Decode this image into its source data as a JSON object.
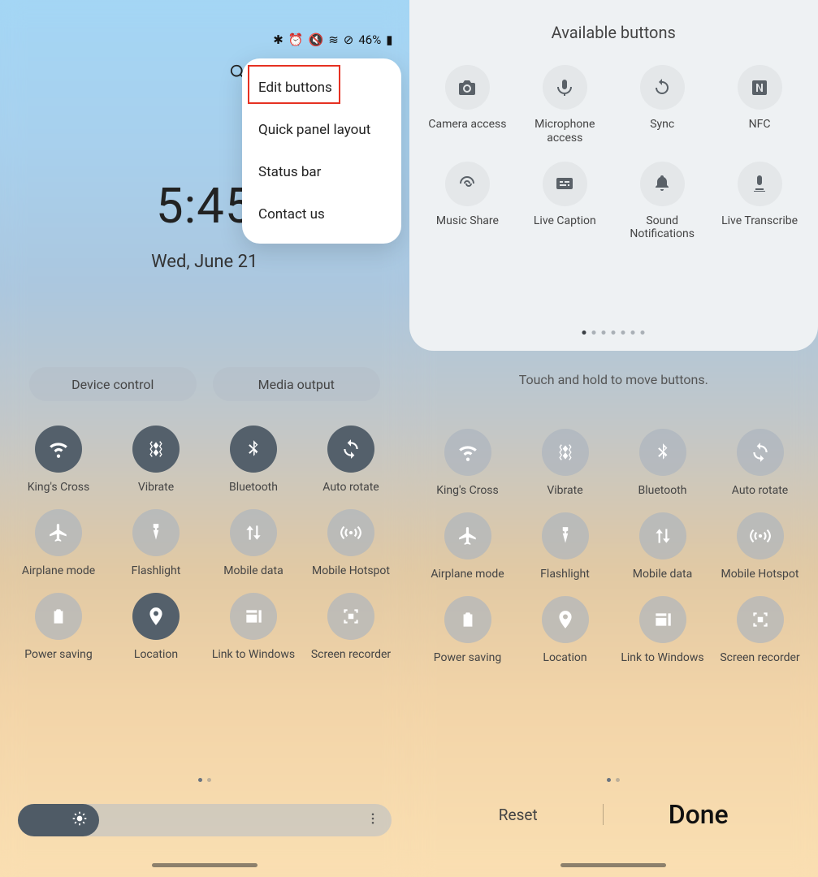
{
  "left": {
    "status": {
      "battery": "46%",
      "bt": "✱",
      "alarm": "⏰",
      "mute": "🔇",
      "wifi": "≋",
      "dnd": "⊘",
      "batt": "▮"
    },
    "time": "5:45",
    "date": "Wed, June 21",
    "pills": {
      "device_control": "Device control",
      "media_output": "Media output"
    },
    "menu": [
      {
        "label": "Edit buttons"
      },
      {
        "label": "Quick panel layout"
      },
      {
        "label": "Status bar"
      },
      {
        "label": "Contact us"
      }
    ]
  },
  "right": {
    "card_title": "Available buttons",
    "available": [
      {
        "label": "Camera access",
        "icon": "camera"
      },
      {
        "label": "Microphone access",
        "icon": "mic"
      },
      {
        "label": "Sync",
        "icon": "sync"
      },
      {
        "label": "NFC",
        "icon": "nfc"
      },
      {
        "label": "Music Share",
        "icon": "music"
      },
      {
        "label": "Live Caption",
        "icon": "caption"
      },
      {
        "label": "Sound Notifications",
        "icon": "bell"
      },
      {
        "label": "Live Transcribe",
        "icon": "transcribe"
      }
    ],
    "instr": "Touch and hold to move buttons.",
    "reset": "Reset",
    "done": "Done"
  },
  "qs": [
    {
      "label": "King's Cross",
      "icon": "wifi",
      "on": true
    },
    {
      "label": "Vibrate",
      "icon": "vibrate",
      "on": true
    },
    {
      "label": "Bluetooth",
      "icon": "bt",
      "on": true
    },
    {
      "label": "Auto rotate",
      "icon": "rotate",
      "on": true
    },
    {
      "label": "Airplane mode",
      "icon": "plane",
      "on": false
    },
    {
      "label": "Flashlight",
      "icon": "flash",
      "on": false
    },
    {
      "label": "Mobile data",
      "icon": "data",
      "on": false
    },
    {
      "label": "Mobile Hotspot",
      "icon": "hotspot",
      "on": false
    },
    {
      "label": "Power saving",
      "icon": "power",
      "on": false
    },
    {
      "label": "Location",
      "icon": "loc",
      "on": true
    },
    {
      "label": "Link to Windows",
      "icon": "win",
      "on": false
    },
    {
      "label": "Screen recorder",
      "icon": "rec",
      "on": false
    }
  ]
}
